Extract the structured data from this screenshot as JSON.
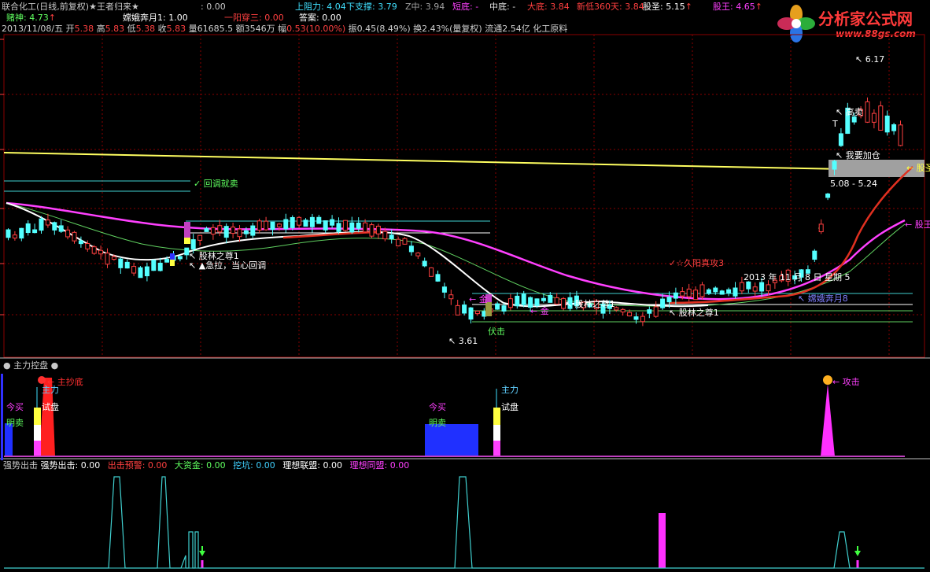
{
  "header": {
    "title": "联合化工(日线,前复权)★王者归来★",
    "title_val": ": 0.00",
    "upper_label": "上阻力: ",
    "upper_val": "4.04",
    "lower_label": "下支撑: ",
    "lower_val": "3.79",
    "zmid_label": "Z中: ",
    "zmid_val": "3.94",
    "short_label": "短底: -",
    "mid_label": "中底: -",
    "big_label": "大底: ",
    "big_val": "3.84",
    "newlow_label": "新低360天: ",
    "newlow_val": "3.84",
    "gusheng_label": "股圣: ",
    "gusheng_val": "5.15",
    "guwang_label": "股王: ",
    "guwang_val": "4.65",
    "arrow": "↑",
    "line2_dushen": "赌神: ",
    "line2_dushen_val": "4.73",
    "line2_chang": "嫦娥奔月1: 1.00",
    "line2_yiyang": "一阳穿三: ",
    "line2_yiyang_val": "0.00",
    "line2_answer": "答案: 0.00",
    "date": "2013/11/08/五",
    "open_label": "开",
    "open_val": "5.38",
    "high_label": "高",
    "high_val": "5.83",
    "low_label": "低",
    "low_val": "5.38",
    "close_label": "收",
    "close_val": "5.83",
    "vol": "量61685.5",
    "amount": "额3546万",
    "range_label": "幅",
    "range_val": "0.53(10.00%)",
    "amp": "振0.45(8.49%)",
    "turnover": "换2.43%(量复权)",
    "float": "流通2.54亿",
    "industry": "化工原料"
  },
  "logo": {
    "main": "分析家公式网",
    "url": "www.88gs.com"
  },
  "annotations": {
    "huitiao": "回调就卖",
    "jila": "急拉，当心回调",
    "gulin1": "股林之尊1",
    "gulin_top": "股林之尊1",
    "jiuyang": "久阳真攻3",
    "date_txt": "2013 年 11 月 8 日 星期 5",
    "gusheng": "股圣",
    "guwang": "股王",
    "changebenyue": "嫦娥奔月8",
    "gulin_right": "股林之尊1",
    "gulin_mid": "股林之尊1",
    "jin": "金",
    "jin2": "金",
    "fuji": "伏击",
    "low_mark": "3.61",
    "high_mark": "6.17",
    "gaomai": "高卖",
    "t_mark": "T",
    "jiacang": "我要加仓",
    "range": "5.08 - 5.24",
    "liang": "量",
    "tui": "推"
  },
  "panel2": {
    "title": "主力控盘",
    "zhuchao": "主抄底",
    "zhuli": "主力",
    "shipan": "试盘",
    "jinmai": "今买",
    "mingmai": "明卖",
    "zhuli2": "主力",
    "shipan2": "试盘",
    "jinmai2": "今买",
    "mingmai2": "明卖",
    "gongji": "攻击"
  },
  "panel3": {
    "title": "强势出击",
    "qs_label": "强势出击: ",
    "qs_val": "0.00",
    "cj_label": "出击预警: ",
    "cj_val": "0.00",
    "dz_label": "大资金: ",
    "dz_val": "0.00",
    "wk_label": "挖坑: ",
    "wk_val": "0.00",
    "lx_label": "理想联盟: ",
    "lx_val": "0.00",
    "lt_label": "理想同盟: ",
    "lt_val": "0.00"
  },
  "colors": {
    "up": "#ff4040",
    "down": "#54ffff",
    "magenta": "#ff40ff",
    "white": "#ffffff",
    "yellow": "#ffff60",
    "green": "#60d060",
    "grid": "#8a0000"
  }
}
